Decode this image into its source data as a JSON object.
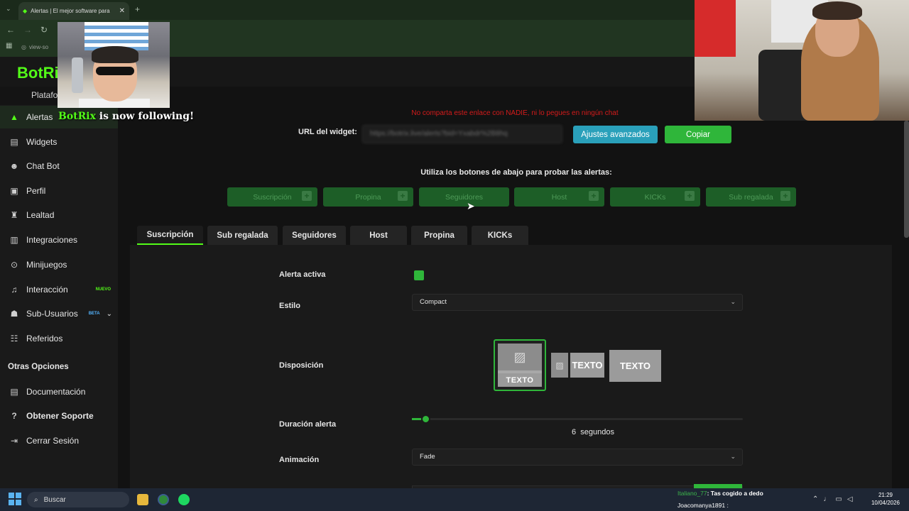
{
  "browser": {
    "tab_title": "Alertas | El mejor software para",
    "url_short": "view-so"
  },
  "overlay": {
    "follower_name": "BotRix",
    "follow_suffix": " is now following!"
  },
  "app": {
    "logo": "BotRi",
    "platform_label": "Platafor"
  },
  "sidebar": {
    "items": [
      {
        "label": "Alertas",
        "icon": "warning-icon"
      },
      {
        "label": "Widgets",
        "icon": "widgets-icon"
      },
      {
        "label": "Chat Bot",
        "icon": "robot-icon"
      },
      {
        "label": "Perfil",
        "icon": "profile-icon"
      },
      {
        "label": "Lealtad",
        "icon": "trophy-icon"
      },
      {
        "label": "Integraciones",
        "icon": "integrations-icon"
      },
      {
        "label": "Minijuegos",
        "icon": "gamepad-icon"
      },
      {
        "label": "Interacción",
        "icon": "music-icon",
        "badge": "NUEVO"
      },
      {
        "label": "Sub-Usuarios",
        "icon": "users-icon",
        "badge": "BETA"
      },
      {
        "label": "Referidos",
        "icon": "referrals-icon"
      }
    ],
    "section_title": "Otras Opciones",
    "other_items": [
      {
        "label": "Documentación",
        "icon": "document-icon"
      },
      {
        "label": "Obtener Soporte",
        "icon": "help-icon"
      },
      {
        "label": "Cerrar Sesión",
        "icon": "logout-icon"
      }
    ]
  },
  "widget": {
    "warning": "No comparta este enlace con NADIE, ni lo pegues en ningún chat",
    "url_label": "URL del widget:",
    "url_value": "https://botrix.live/alerts?bid=Yxabdr%2B8hq",
    "advanced_button": "Ajustes avanzados",
    "copy_button": "Copiar",
    "test_hint": "Utiliza los botones de abajo para probar las alertas:",
    "test_buttons": [
      "Suscripción",
      "Propina",
      "Seguidores",
      "Host",
      "KICKs",
      "Sub regalada"
    ]
  },
  "tabs": [
    "Suscripción",
    "Sub regalada",
    "Seguidores",
    "Host",
    "Propina",
    "KICKs"
  ],
  "form": {
    "active_label": "Alerta activa",
    "style_label": "Estilo",
    "style_value": "Compact",
    "layout_label": "Disposición",
    "layout_text": "TEXTO",
    "duration_label": "Duración alerta",
    "duration_value": "6",
    "duration_unit": "segundos",
    "animation_label": "Animación",
    "animation_value": "Fade"
  },
  "taskbar": {
    "search_placeholder": "Buscar",
    "chat_user1": "Italiano_77",
    "chat_msg1": ": Tas cogido a dedo",
    "chat_user2": "Joacomanya1891",
    "chat_msg2": ":",
    "time": "21:29",
    "date": "10/04/2026"
  },
  "colors": {
    "accent": "#53fc18",
    "button_green": "#2fb63a",
    "button_blue": "#2aa0ba",
    "warning_red": "#d41b1b"
  }
}
